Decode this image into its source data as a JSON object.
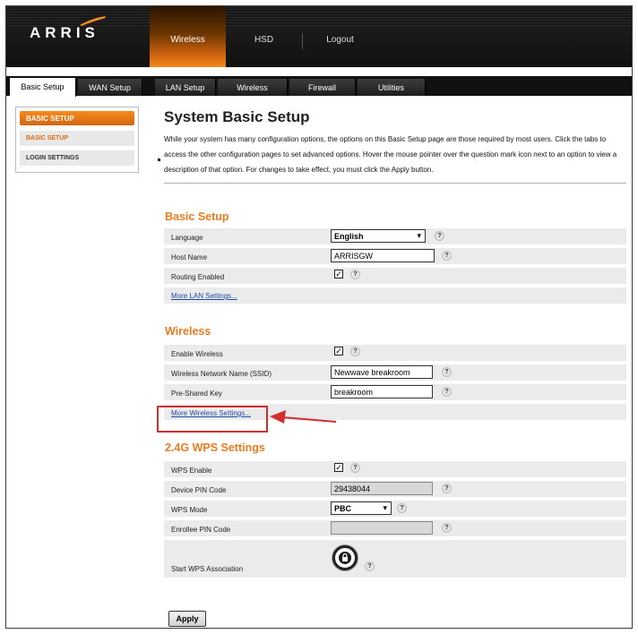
{
  "brand": {
    "logo_text": "ARRIS",
    "accent": "#ed7b1e"
  },
  "topnav": {
    "items": [
      "Wireless",
      "HSD",
      "Logout"
    ],
    "active": "Wireless"
  },
  "tabs": {
    "items": [
      "Basic Setup",
      "WAN Setup",
      "LAN Setup",
      "Wireless",
      "Firewall",
      "Utilities"
    ],
    "active": "Basic Setup"
  },
  "sidebar": {
    "header": "BASIC SETUP",
    "items": [
      "BASIC SETUP",
      "LOGIN SETTINGS"
    ]
  },
  "page": {
    "title": "System Basic Setup",
    "intro": "While your system has many configuration options, the options on this Basic Setup page are those required by most users. Click the tabs to access the other configuration pages to set advanced options. Hover the mouse pointer over the question mark icon next to an option to view a description of that option. For changes to take effect, you must click the Apply button."
  },
  "basic_setup": {
    "title": "Basic Setup",
    "language_label": "Language",
    "language_value": "English",
    "host_label": "Host Name",
    "host_value": "ARRISGW",
    "routing_label": "Routing Enabled",
    "routing_checked": true,
    "more_link": "More LAN Settings..."
  },
  "wireless": {
    "title": "Wireless",
    "enable_label": "Enable Wireless",
    "enable_checked": true,
    "ssid_label": "Wireless Network Name (SSID)",
    "ssid_value": "Newwave breakroom",
    "psk_label": "Pre-Shared Key",
    "psk_value": "breakroom",
    "more_link": "More Wireless Settings..."
  },
  "wps": {
    "title": "2.4G WPS Settings",
    "enable_label": "WPS Enable",
    "enable_checked": true,
    "pin_label": "Device PIN Code",
    "pin_value": "29438044",
    "mode_label": "WPS Mode",
    "mode_value": "PBC",
    "enrollee_label": "Enrollee PIN Code",
    "enrollee_value": "",
    "start_label": "Start WPS Association"
  },
  "help_glyph": "?",
  "check_glyph": "✓",
  "select_arrow": "▾",
  "apply_label": "Apply",
  "annotation": {
    "highlight_color": "#d42d2d"
  }
}
